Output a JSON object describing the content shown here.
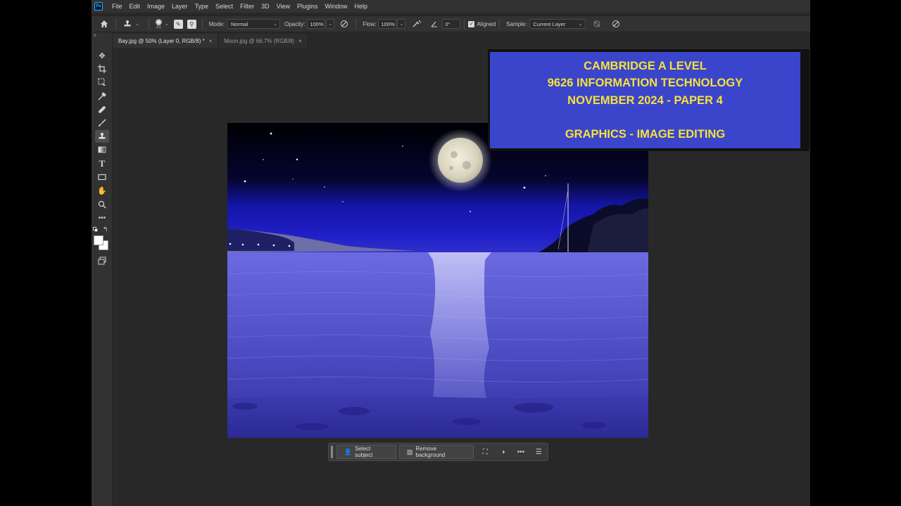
{
  "menubar": {
    "logo": "Ps",
    "items": [
      "File",
      "Edit",
      "Image",
      "Layer",
      "Type",
      "Select",
      "Filter",
      "3D",
      "View",
      "Plugins",
      "Window",
      "Help"
    ]
  },
  "options": {
    "brush_size": "21",
    "mode_label": "Mode:",
    "mode_value": "Normal",
    "opacity_label": "Opacity:",
    "opacity_value": "100%",
    "flow_label": "Flow:",
    "flow_value": "100%",
    "angle_value": "0°",
    "aligned_label": "Aligned",
    "sample_label": "Sample:",
    "sample_value": "Current Layer"
  },
  "tabs": [
    {
      "label": "Bay.jpg @ 50% (Layer 0, RGB/8) *",
      "active": true
    },
    {
      "label": "Moon.jpg @ 66.7% (RGB/8)",
      "active": false
    }
  ],
  "context_bar": {
    "select_subject": "Select subject",
    "remove_background": "Remove background"
  },
  "banner": {
    "line1": "CAMBRIDGE A LEVEL",
    "line2": "9626 INFORMATION TECHNOLOGY",
    "line3": "NOVEMBER 2024 - PAPER 4",
    "line4": "GRAPHICS - IMAGE EDITING"
  },
  "colors": {
    "banner_bg": "#3b45cc",
    "banner_text": "#f5e23a",
    "sky": "#1a1a9e",
    "water": "#6a6ad8"
  }
}
